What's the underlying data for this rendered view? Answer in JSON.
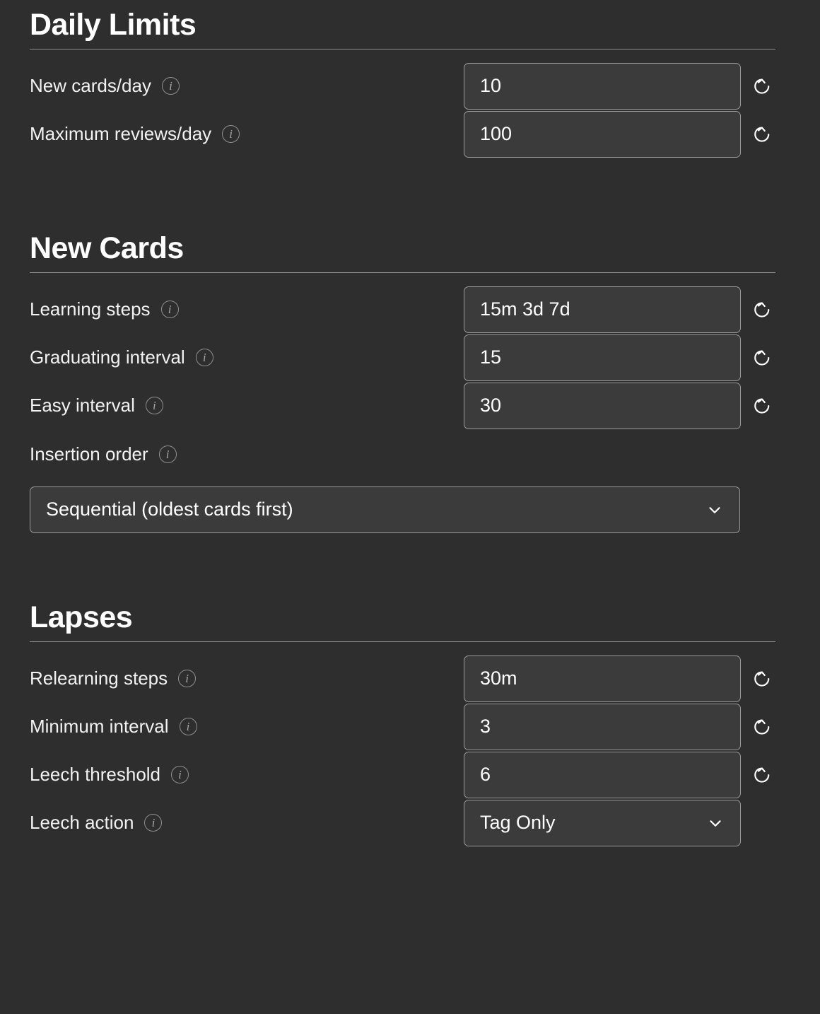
{
  "sections": [
    {
      "id": "daily-limits",
      "title": "Daily Limits",
      "rows": [
        {
          "label": "New cards/day",
          "control": "input",
          "value": "10",
          "has_reset": true,
          "info_icon": "info-icon",
          "reset_icon": "reset-icon"
        },
        {
          "label": "Maximum reviews/day",
          "control": "input",
          "value": "100",
          "has_reset": true,
          "info_icon": "info-icon",
          "reset_icon": "reset-icon"
        }
      ]
    },
    {
      "id": "new-cards",
      "title": "New Cards",
      "rows": [
        {
          "label": "Learning steps",
          "control": "input",
          "value": "15m 3d 7d",
          "has_reset": true,
          "info_icon": "info-icon",
          "reset_icon": "reset-icon"
        },
        {
          "label": "Graduating interval",
          "control": "input",
          "value": "15",
          "has_reset": true,
          "info_icon": "info-icon",
          "reset_icon": "reset-icon"
        },
        {
          "label": "Easy interval",
          "control": "input",
          "value": "30",
          "has_reset": true,
          "info_icon": "info-icon",
          "reset_icon": "reset-icon"
        },
        {
          "label": "Insertion order",
          "control": "select-stacked",
          "value": "Sequential (oldest cards first)",
          "has_reset": false,
          "info_icon": "info-icon",
          "chevron_icon": "chevron-down-icon"
        }
      ]
    },
    {
      "id": "lapses",
      "title": "Lapses",
      "rows": [
        {
          "label": "Relearning steps",
          "control": "input",
          "value": "30m",
          "has_reset": true,
          "info_icon": "info-icon",
          "reset_icon": "reset-icon"
        },
        {
          "label": "Minimum interval",
          "control": "input",
          "value": "3",
          "has_reset": true,
          "info_icon": "info-icon",
          "reset_icon": "reset-icon"
        },
        {
          "label": "Leech threshold",
          "control": "input",
          "value": "6",
          "has_reset": true,
          "info_icon": "info-icon",
          "reset_icon": "reset-icon"
        },
        {
          "label": "Leech action",
          "control": "select",
          "value": "Tag Only",
          "has_reset": false,
          "info_icon": "info-icon",
          "chevron_icon": "chevron-down-icon"
        }
      ]
    }
  ],
  "colors": {
    "background": "#2e2e2e",
    "field_background": "#3b3b3b",
    "field_border": "#9a9a9a",
    "text": "#ffffff",
    "muted": "#8f8f8f",
    "rule": "#8d8d8d"
  }
}
